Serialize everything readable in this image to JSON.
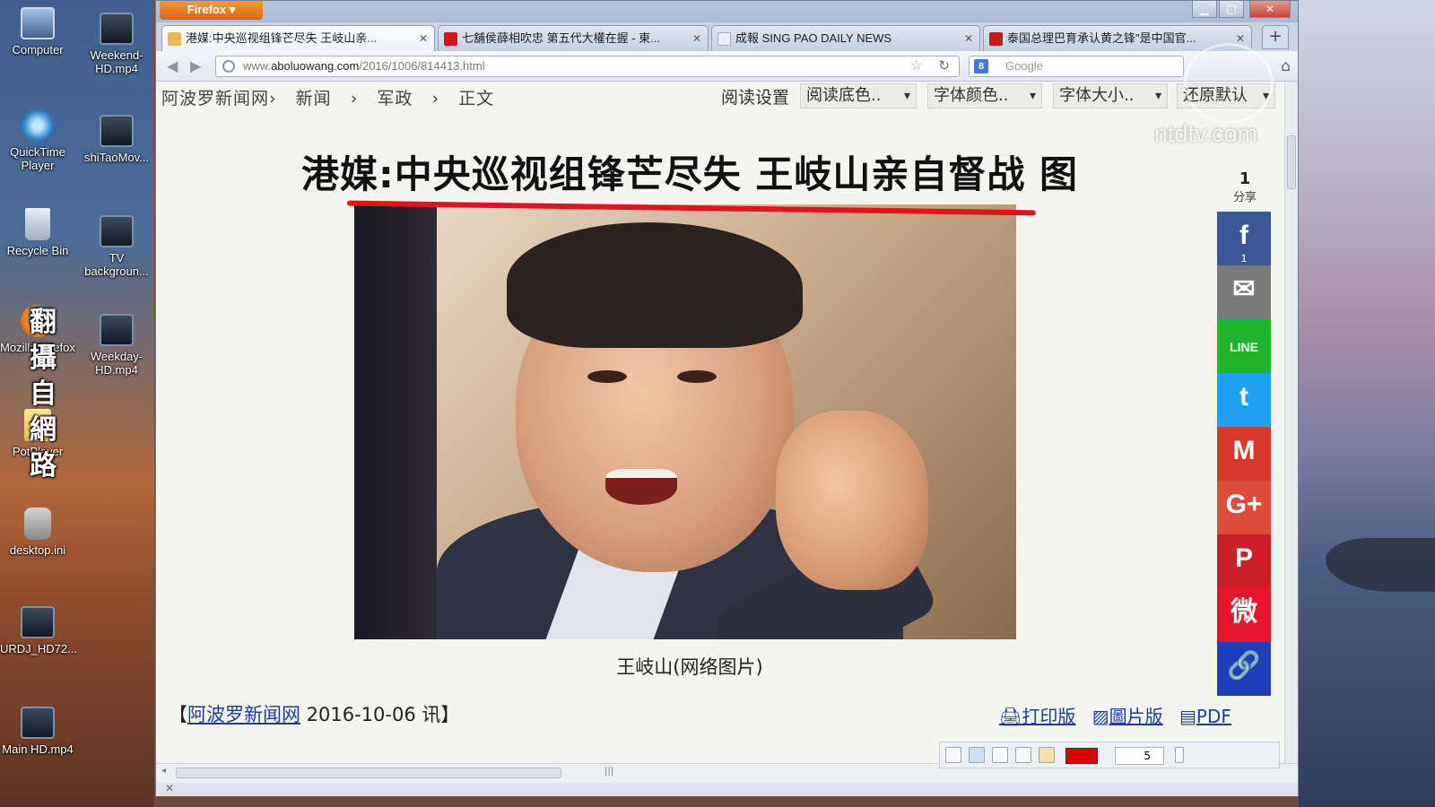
{
  "desktop": {
    "icons": [
      {
        "label": "Computer",
        "icon": "computer-icon"
      },
      {
        "label": "Weekend-HD.mp4",
        "icon": "video-file-icon"
      },
      {
        "label": "QuickTime Player",
        "icon": "quicktime-icon"
      },
      {
        "label": "shiTaoMov...",
        "icon": "video-file-icon"
      },
      {
        "label": "Recycle Bin",
        "icon": "recycle-bin-icon"
      },
      {
        "label": "TV backgroun...",
        "icon": "video-file-icon"
      },
      {
        "label": "Mozilla Firefox",
        "icon": "firefox-icon"
      },
      {
        "label": "Weekday-HD.mp4",
        "icon": "video-file-icon"
      },
      {
        "label": "PotPlayer",
        "icon": "folder-icon"
      },
      {
        "label": "desktop.ini",
        "icon": "settings-file-icon"
      },
      {
        "label": "URDJ_HD72...",
        "icon": "video-file-icon"
      },
      {
        "label": "Main HD.mp4",
        "icon": "video-file-icon"
      }
    ]
  },
  "window": {
    "app_button": "Firefox ▾",
    "tabs": [
      {
        "label": "港媒:中央巡视组锋芒尽失 王岐山亲...",
        "active": true
      },
      {
        "label": "七舖侯薛相吹忠 第五代大權在握 - 東...",
        "active": false
      },
      {
        "label": "成報 SING PAO DAILY NEWS",
        "active": false
      },
      {
        "label": "泰国总理巴育承认黄之锋\"是中国官...",
        "active": false
      }
    ],
    "url_prefix": "www.",
    "url_domain": "aboluowang.com",
    "url_path": "/2016/1006/814413.html",
    "search_placeholder": "Google",
    "search_engine": "8"
  },
  "page": {
    "breadcrumb": [
      "阿波罗新闻网›",
      "新闻",
      "›",
      "军政",
      "›",
      "正文"
    ],
    "reading_settings": "阅读设置",
    "dropdowns": [
      "阅读底色..",
      "字体颜色..",
      "字体大小..",
      "还原默认"
    ],
    "headline": "港媒:中央巡视组锋芒尽失 王岐山亲自督战 图",
    "caption": "王岐山(网络图片)",
    "source_open": "【",
    "source_name": "阿波罗新闻网",
    "source_date": " 2016-10-06 讯】",
    "print_link": "打印版",
    "image_link": "圖片版",
    "pdf_link": "PDF",
    "share_count": "1",
    "share_label": "分享",
    "share_buttons": [
      {
        "name": "facebook",
        "glyph": "f",
        "color": "#3b5998",
        "count": "1"
      },
      {
        "name": "email",
        "glyph": "✉",
        "color": "#7a7a7a",
        "count": ""
      },
      {
        "name": "line",
        "glyph": "LINE",
        "color": "#1fb42b",
        "count": ""
      },
      {
        "name": "twitter",
        "glyph": "t",
        "color": "#1da1f2",
        "count": ""
      },
      {
        "name": "gmail",
        "glyph": "M",
        "color": "#d8382c",
        "count": ""
      },
      {
        "name": "google-plus",
        "glyph": "G+",
        "color": "#dd4b39",
        "count": ""
      },
      {
        "name": "pinterest",
        "glyph": "P",
        "color": "#cb2027",
        "count": ""
      },
      {
        "name": "weibo",
        "glyph": "微",
        "color": "#e6162d",
        "count": ""
      },
      {
        "name": "copy-link",
        "glyph": "🔗",
        "color": "#1f3fb8",
        "count": ""
      }
    ]
  },
  "overlay": {
    "vertical_note": [
      "翻",
      "攝",
      "自",
      "網",
      "路"
    ],
    "watermark": "ntdtv.com",
    "brush_size": "5"
  }
}
